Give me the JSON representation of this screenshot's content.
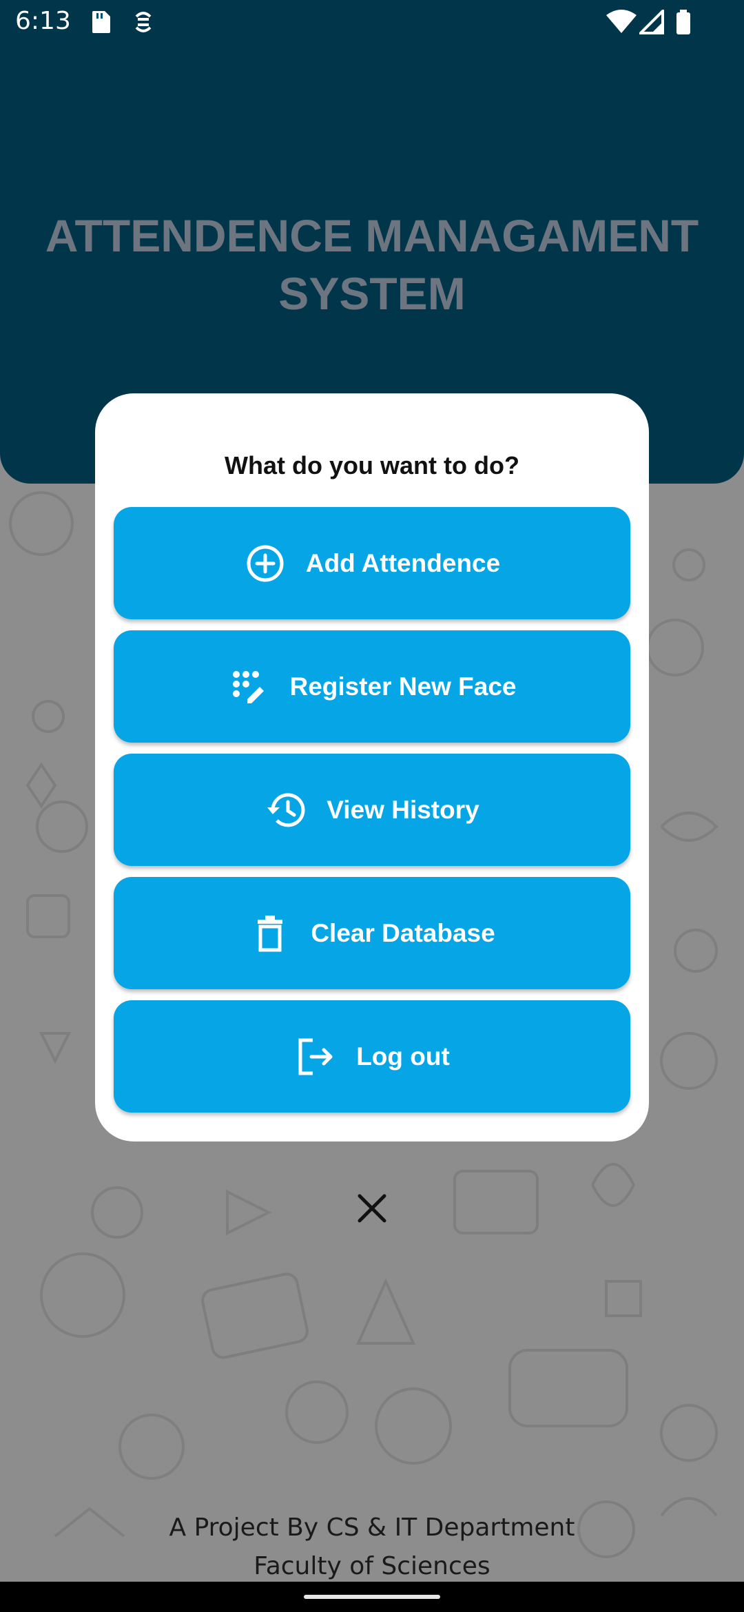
{
  "status_bar": {
    "time": "6:13",
    "icons": [
      "sd-card-icon",
      "sync-icon",
      "wifi-icon",
      "signal-icon",
      "battery-icon"
    ]
  },
  "header": {
    "title_line1": "ATTENDENCE MANAGAMENT",
    "title_line2": "SYSTEM",
    "color": "#02506d"
  },
  "dialog": {
    "title": "What do you want to do?",
    "buttons": [
      {
        "label": "Add Attendence",
        "icon": "add-circle-icon"
      },
      {
        "label": "Register New Face",
        "icon": "register-face-icon"
      },
      {
        "label": "View History",
        "icon": "history-icon"
      },
      {
        "label": "Clear Database",
        "icon": "trash-icon"
      },
      {
        "label": "Log out",
        "icon": "logout-icon"
      }
    ],
    "button_color": "#06a6e6"
  },
  "close": {
    "icon": "close-icon"
  },
  "footer": {
    "line1": "A Project By CS & IT Department",
    "line2": "Faculty of Sciences"
  }
}
